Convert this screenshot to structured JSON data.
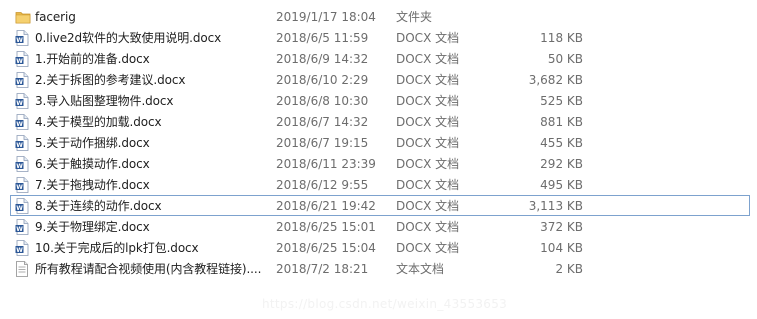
{
  "files": [
    {
      "name": "facerig",
      "date": "2019/1/17 18:04",
      "type": "文件夹",
      "size": "",
      "icon": "folder-icon",
      "selected": false
    },
    {
      "name": "0.live2d软件的大致使用说明.docx",
      "date": "2018/6/5 11:59",
      "type": "DOCX 文档",
      "size": "118 KB",
      "icon": "docx-icon",
      "selected": false
    },
    {
      "name": "1.开始前的准备.docx",
      "date": "2018/6/9 14:32",
      "type": "DOCX 文档",
      "size": "50 KB",
      "icon": "docx-icon",
      "selected": false
    },
    {
      "name": "2.关于拆图的参考建议.docx",
      "date": "2018/6/10 2:29",
      "type": "DOCX 文档",
      "size": "3,682 KB",
      "icon": "docx-icon",
      "selected": false
    },
    {
      "name": "3.导入贴图整理物件.docx",
      "date": "2018/6/8 10:30",
      "type": "DOCX 文档",
      "size": "525 KB",
      "icon": "docx-icon",
      "selected": false
    },
    {
      "name": "4.关于模型的加载.docx",
      "date": "2018/6/7 14:32",
      "type": "DOCX 文档",
      "size": "881 KB",
      "icon": "docx-icon",
      "selected": false
    },
    {
      "name": "5.关于动作捆绑.docx",
      "date": "2018/6/7 19:15",
      "type": "DOCX 文档",
      "size": "455 KB",
      "icon": "docx-icon",
      "selected": false
    },
    {
      "name": "6.关于触摸动作.docx",
      "date": "2018/6/11 23:39",
      "type": "DOCX 文档",
      "size": "292 KB",
      "icon": "docx-icon",
      "selected": false
    },
    {
      "name": "7.关于拖拽动作.docx",
      "date": "2018/6/12 9:55",
      "type": "DOCX 文档",
      "size": "495 KB",
      "icon": "docx-icon",
      "selected": false
    },
    {
      "name": "8.关于连续的动作.docx",
      "date": "2018/6/21 19:42",
      "type": "DOCX 文档",
      "size": "3,113 KB",
      "icon": "docx-icon",
      "selected": true
    },
    {
      "name": "9.关于物理绑定.docx",
      "date": "2018/6/25 15:01",
      "type": "DOCX 文档",
      "size": "372 KB",
      "icon": "docx-icon",
      "selected": false
    },
    {
      "name": "10.关于完成后的lpk打包.docx",
      "date": "2018/6/25 15:04",
      "type": "DOCX 文档",
      "size": "104 KB",
      "icon": "docx-icon",
      "selected": false
    },
    {
      "name": "所有教程请配合视频使用(内含教程链接)....",
      "date": "2018/7/2 18:21",
      "type": "文本文档",
      "size": "2 KB",
      "icon": "text-file-icon",
      "selected": false
    }
  ],
  "watermark": "https://blog.csdn.net/weixin_43553653",
  "colors": {
    "folder": "#e8b949",
    "docx_blue": "#2b5797",
    "selection_border": "#7da2ce"
  }
}
